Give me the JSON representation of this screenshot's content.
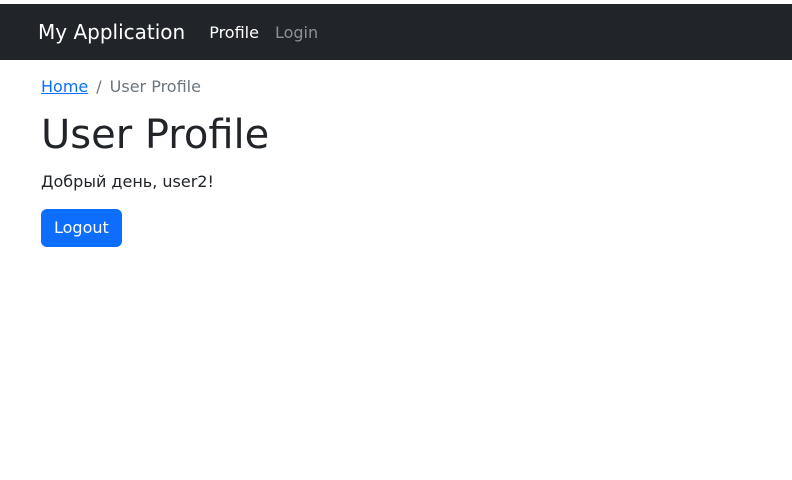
{
  "navbar": {
    "brand": "My Application",
    "links": [
      {
        "label": "Profile",
        "active": true
      },
      {
        "label": "Login",
        "active": false
      }
    ]
  },
  "breadcrumb": {
    "home": "Home",
    "separator": "/",
    "current": "User Profile"
  },
  "main": {
    "title": "User Profile",
    "greeting": "Добрый день, user2!",
    "logout_label": "Logout"
  },
  "colors": {
    "navbar_bg": "#212529",
    "primary": "#0d6efd",
    "muted": "#6c757d"
  }
}
